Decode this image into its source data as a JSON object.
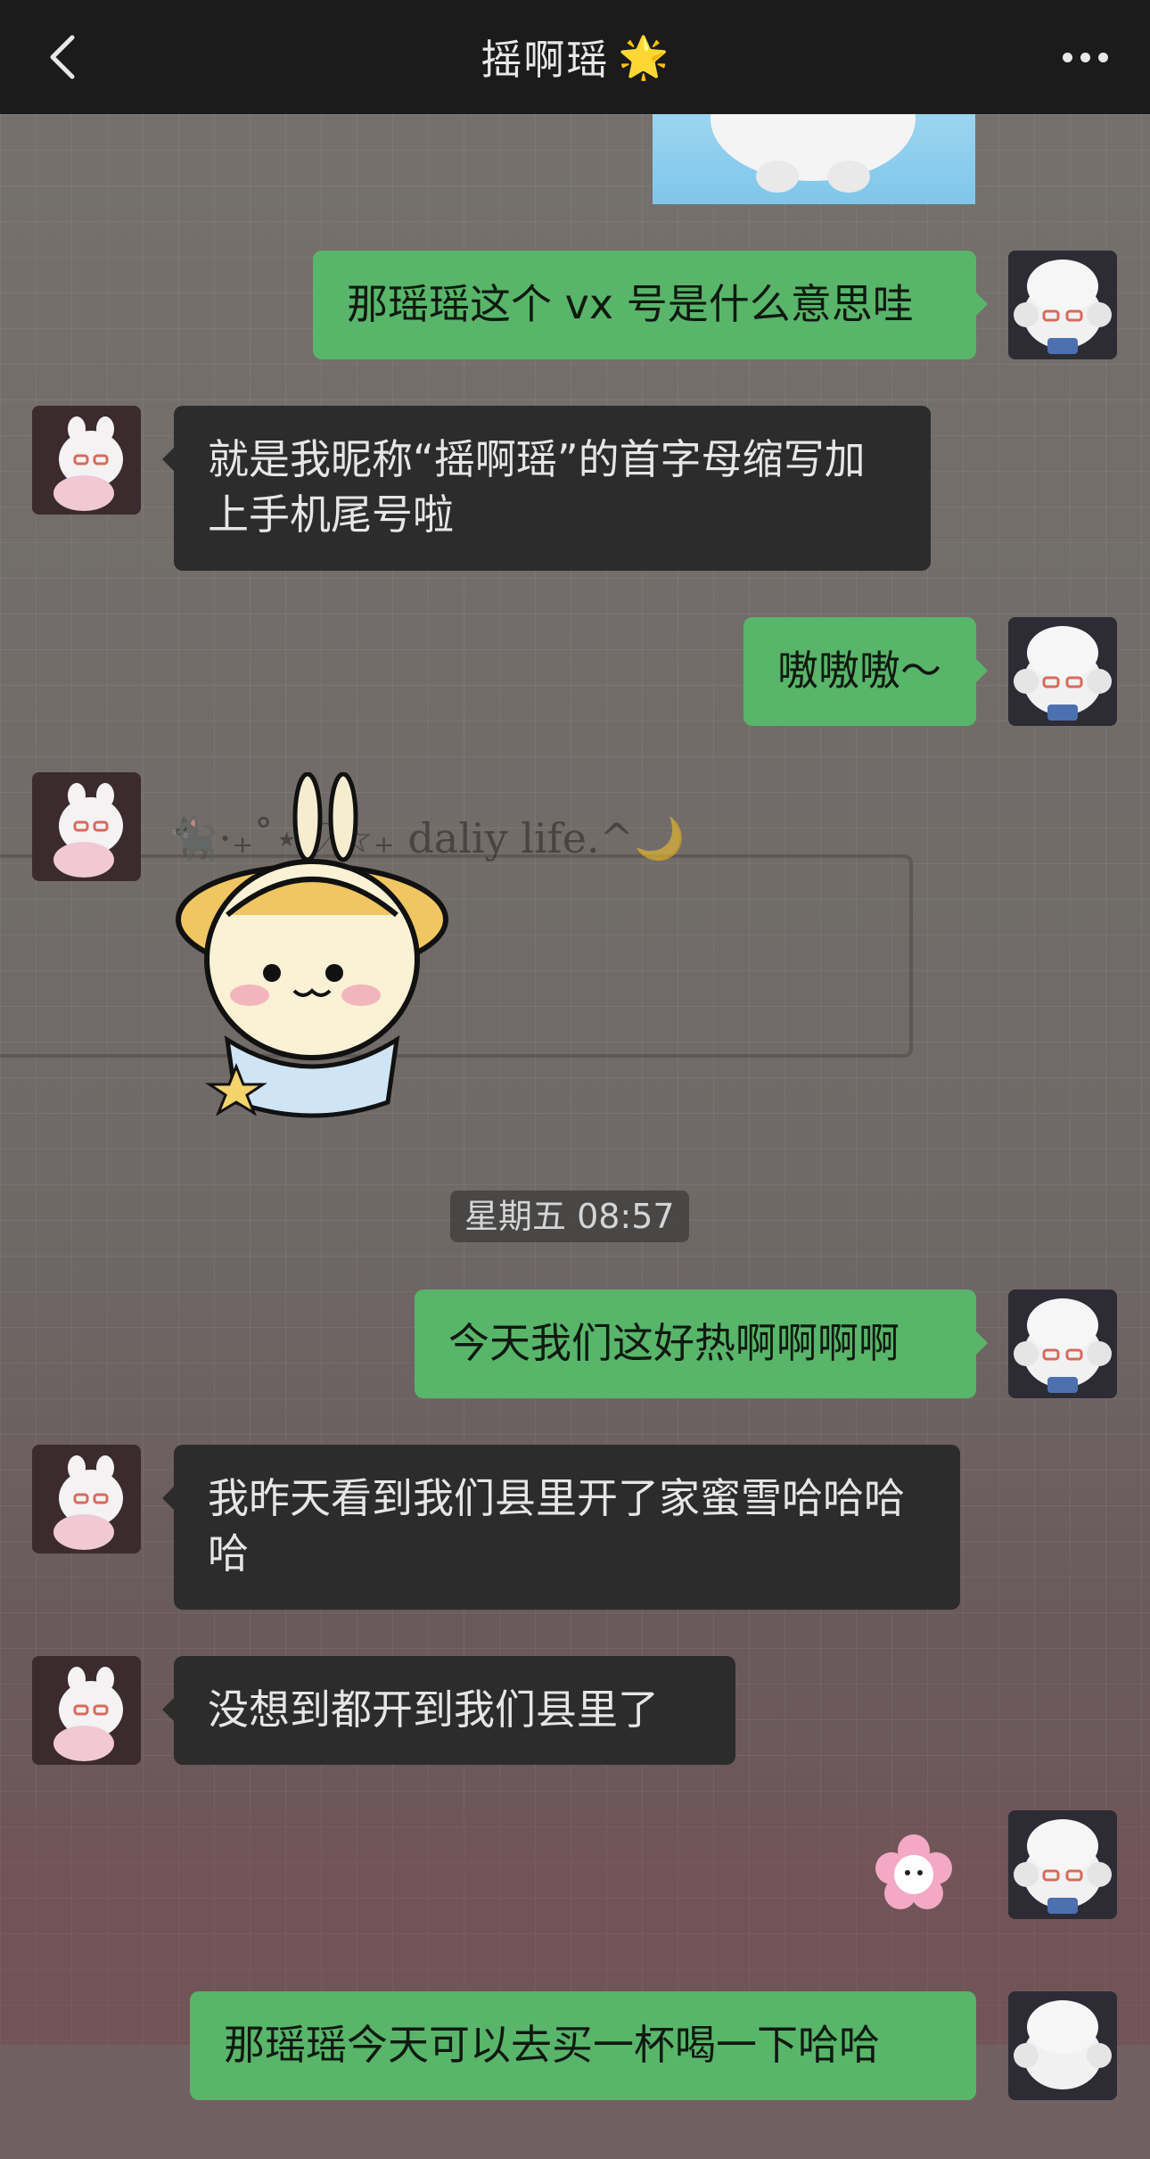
{
  "header": {
    "title": "摇啊瑶",
    "title_emoji": "🌟",
    "back_icon": "chevron-left-icon",
    "more_icon": "more-dots-icon"
  },
  "wallpaper": {
    "deco_text": "🐈‍⬛·₊˚⋆♡☆₊ daliy life.^🌙"
  },
  "messages": [
    {
      "side": "out",
      "text": "那瑶瑶这个 vx 号是什么意思哇"
    },
    {
      "side": "in",
      "text": "就是我昵称“摇啊瑶”的首字母缩写加上手机尾号啦"
    },
    {
      "side": "out",
      "text": "嗷嗷嗷～"
    },
    {
      "side": "in",
      "type": "sticker",
      "name": "bunny-hat-sticker"
    },
    {
      "type": "timestamp",
      "text": "星期五 08:57"
    },
    {
      "side": "out",
      "text": "今天我们这好热啊啊啊啊"
    },
    {
      "side": "in",
      "text": "我昨天看到我们县里开了家蜜雪哈哈哈哈"
    },
    {
      "side": "in",
      "text": "没想到都开到我们县里了"
    },
    {
      "side": "out",
      "type": "sticker",
      "name": "pink-flower-sticker"
    },
    {
      "side": "out",
      "text": "那瑶瑶今天可以去买一杯喝一下哈哈"
    }
  ],
  "colors": {
    "header_bg": "#1b1b1b",
    "outgoing_bubble": "#59b56a",
    "incoming_bubble": "#2c2c2c"
  }
}
